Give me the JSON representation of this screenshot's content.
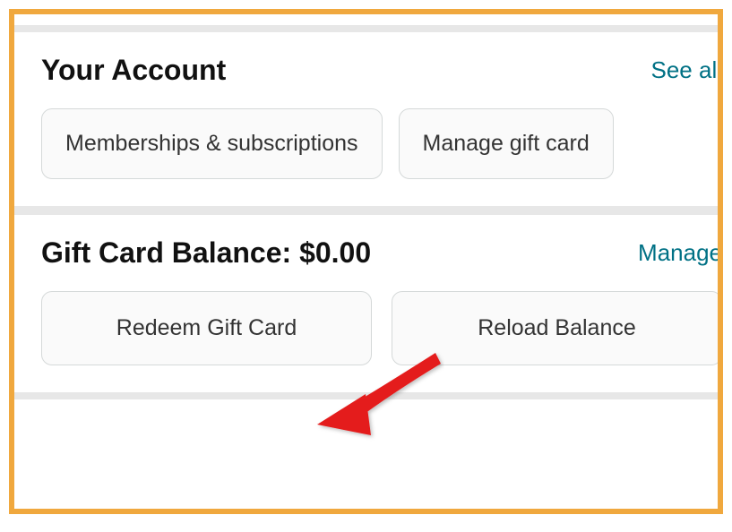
{
  "account_section": {
    "title": "Your Account",
    "see_all": "See all",
    "buttons": {
      "memberships": "Memberships & subscriptions",
      "manage_gift": "Manage gift card "
    }
  },
  "gift_section": {
    "title": "Gift Card Balance: $0.00",
    "manage": "Manage",
    "buttons": {
      "redeem": "Redeem Gift Card",
      "reload": "Reload Balance"
    }
  }
}
